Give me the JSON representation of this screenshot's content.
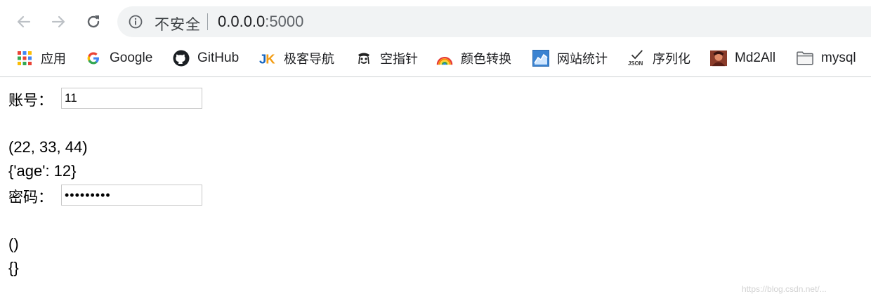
{
  "browser": {
    "security_label": "不安全",
    "url_host": "0.0.0.0",
    "url_port": ":5000"
  },
  "bookmarks": [
    {
      "label": "应用",
      "icon": "apps-grid-icon"
    },
    {
      "label": "Google",
      "icon": "google-g-icon"
    },
    {
      "label": "GitHub",
      "icon": "github-octocat-icon"
    },
    {
      "label": "极客导航",
      "icon": "jk-logo-icon"
    },
    {
      "label": "空指针",
      "icon": "null-pointer-logo-icon"
    },
    {
      "label": "颜色转换",
      "icon": "rainbow-icon"
    },
    {
      "label": "网站统计",
      "icon": "stats-chart-icon"
    },
    {
      "label": "序列化",
      "icon": "json-check-icon"
    },
    {
      "label": "Md2All",
      "icon": "md2all-avatar-icon"
    },
    {
      "label": "mysql",
      "icon": "folder-icon"
    }
  ],
  "page": {
    "account_label": "账号：",
    "account_value": "11",
    "tuple_line": "(22, 33, 44)",
    "dict_line": "{'age': 12}",
    "password_label": "密码：",
    "password_value": "123456789",
    "empty_tuple_line": "()",
    "empty_dict_line": "{}"
  },
  "watermark": "https://blog.csdn.net/..."
}
